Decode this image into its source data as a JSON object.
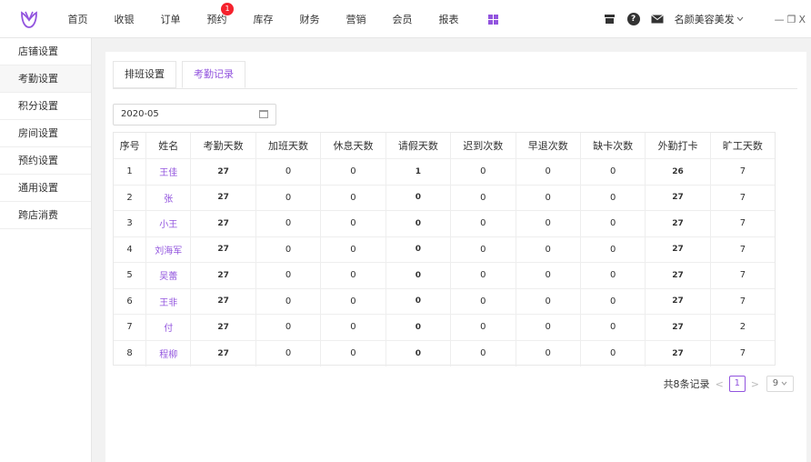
{
  "nav": {
    "items": [
      "首页",
      "收银",
      "订单",
      "预约",
      "库存",
      "财务",
      "营销",
      "会员",
      "报表"
    ],
    "badge_count": "1",
    "store_name": "名颜美容美发",
    "help_label": "?",
    "win_min": "—",
    "win_restore": "❐",
    "win_close": "X"
  },
  "sidebar": {
    "items": [
      "店铺设置",
      "考勤设置",
      "积分设置",
      "房间设置",
      "预约设置",
      "通用设置",
      "跨店消费"
    ]
  },
  "tabs": [
    "排班设置",
    "考勤记录"
  ],
  "date_value": "2020-05",
  "table": {
    "headers": [
      "序号",
      "姓名",
      "考勤天数",
      "加班天数",
      "休息天数",
      "请假天数",
      "迟到次数",
      "早退次数",
      "缺卡次数",
      "外勤打卡",
      "旷工天数"
    ],
    "rows": [
      [
        "1",
        "王佳",
        "27",
        "0",
        "0",
        "1",
        "0",
        "0",
        "0",
        "26",
        "7"
      ],
      [
        "2",
        "张",
        "27",
        "0",
        "0",
        "0",
        "0",
        "0",
        "0",
        "27",
        "7"
      ],
      [
        "3",
        "小王",
        "27",
        "0",
        "0",
        "0",
        "0",
        "0",
        "0",
        "27",
        "7"
      ],
      [
        "4",
        "刘海军",
        "27",
        "0",
        "0",
        "0",
        "0",
        "0",
        "0",
        "27",
        "7"
      ],
      [
        "5",
        "吴蕾",
        "27",
        "0",
        "0",
        "0",
        "0",
        "0",
        "0",
        "27",
        "7"
      ],
      [
        "6",
        "王非",
        "27",
        "0",
        "0",
        "0",
        "0",
        "0",
        "0",
        "27",
        "7"
      ],
      [
        "7",
        "付",
        "27",
        "0",
        "0",
        "0",
        "0",
        "0",
        "0",
        "27",
        "2"
      ],
      [
        "8",
        "程柳",
        "27",
        "0",
        "0",
        "0",
        "0",
        "0",
        "0",
        "27",
        "7"
      ]
    ]
  },
  "pager": {
    "total_text": "共8条记录",
    "prev": "<",
    "current": "1",
    "next": ">",
    "page_size": "9"
  },
  "colors": {
    "accent": "#9254de",
    "badge": "#f5222d"
  }
}
